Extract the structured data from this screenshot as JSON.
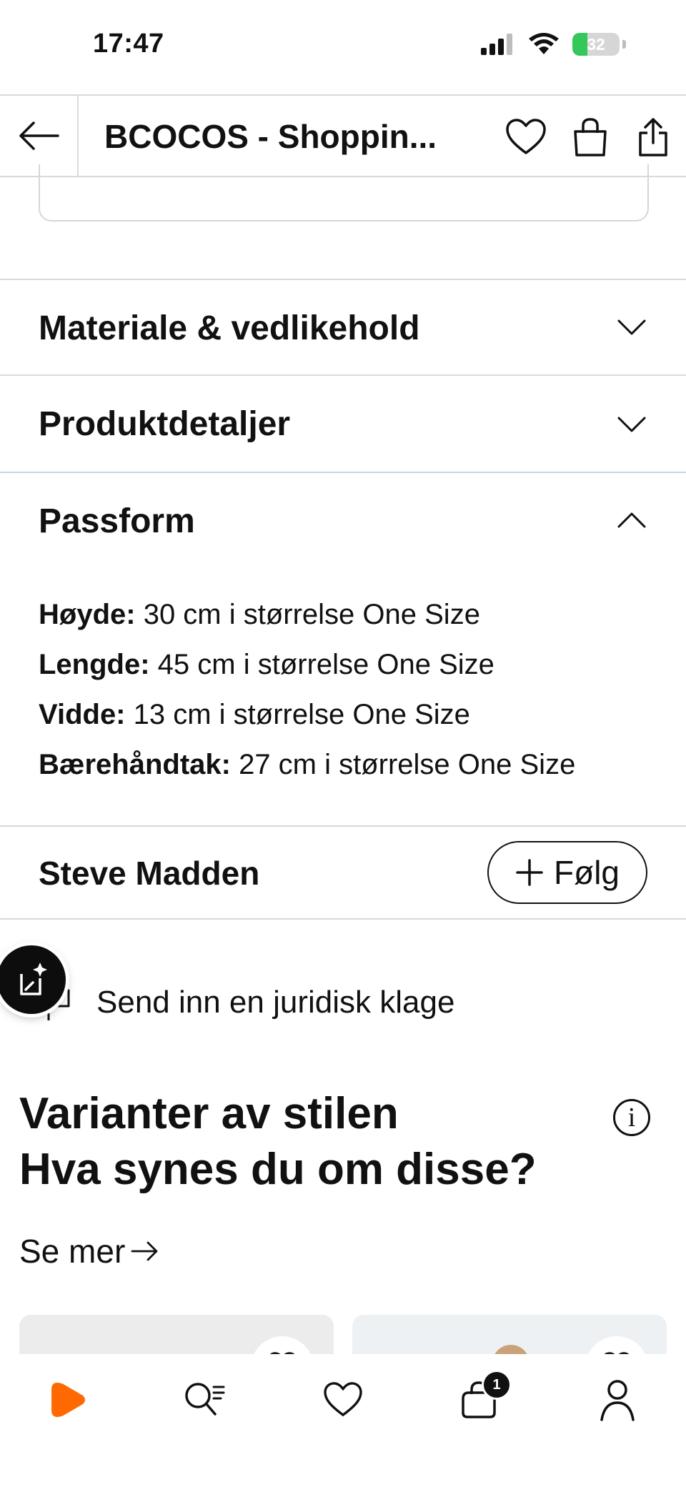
{
  "status": {
    "time": "17:47",
    "battery": "32",
    "battery_level": 0.32
  },
  "header": {
    "title": "BCOCOS - Shoppin..."
  },
  "accordion": {
    "material": "Materiale & vedlikehold",
    "details": "Produktdetaljer",
    "fit": "Passform"
  },
  "specs": [
    {
      "label": "Høyde:",
      "value": " 30 cm i størrelse One Size"
    },
    {
      "label": "Lengde:",
      "value": " 45 cm i størrelse One Size"
    },
    {
      "label": "Vidde:",
      "value": " 13 cm i størrelse One Size"
    },
    {
      "label": "Bærehåndtak:",
      "value": " 27 cm i størrelse One Size"
    }
  ],
  "brand": {
    "name": "Steve Madden",
    "follow_label": "Følg"
  },
  "complaint": {
    "label": "Send inn en juridisk klage"
  },
  "variants": {
    "title_line1": "Varianter av stilen",
    "title_line2": "Hva synes du om disse?",
    "see_more": "Se mer"
  },
  "nav": {
    "cart_badge": "1"
  },
  "colors": {
    "accent": "#ff6900",
    "text": "#111111",
    "divider": "#d9d9d9"
  },
  "icons": [
    "back-arrow-icon",
    "heart-icon",
    "bag-icon",
    "share-icon",
    "chevron-down-icon",
    "chevron-up-icon",
    "plus-icon",
    "flag-icon",
    "ai-assistant-icon",
    "info-icon",
    "arrow-right-icon",
    "home-logo-icon",
    "search-icon",
    "wishlist-icon",
    "cart-icon",
    "profile-icon"
  ]
}
